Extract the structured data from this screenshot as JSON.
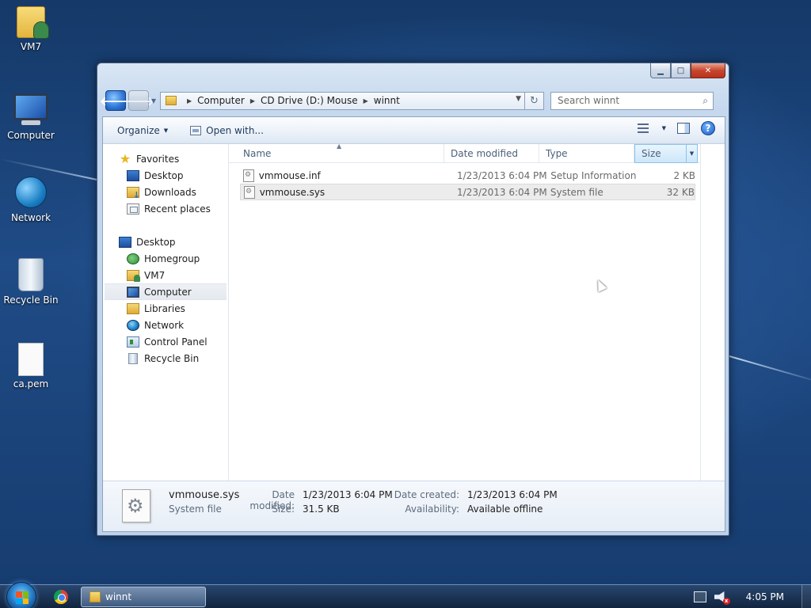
{
  "desktop": {
    "icons": [
      {
        "label": "VM7",
        "icon": "user-folder-icon"
      },
      {
        "label": "Computer",
        "icon": "computer-icon"
      },
      {
        "label": "Network",
        "icon": "network-icon"
      },
      {
        "label": "Recycle Bin",
        "icon": "recycle-bin-icon"
      },
      {
        "label": "ca.pem",
        "icon": "document-icon"
      }
    ]
  },
  "window": {
    "caption_buttons": {
      "minimize": "▁",
      "maximize": "□",
      "close": "✕"
    },
    "nav": {
      "back": "🡐",
      "forward": "🡒",
      "recent_dropdown": "▼"
    },
    "address": {
      "breadcrumbs": [
        "Computer",
        "CD Drive (D:) Mouse",
        "winnt"
      ],
      "separator": "▶",
      "dropdown": "▼",
      "refresh": "↻"
    },
    "search": {
      "placeholder": "Search winnt",
      "icon": "⌕"
    },
    "toolbar": {
      "organize": "Organize",
      "open_with": "Open with...",
      "caret": "▼",
      "help": "?"
    },
    "nav_pane": {
      "favorites_header": "Favorites",
      "favorites": [
        "Desktop",
        "Downloads",
        "Recent places"
      ],
      "tree_root": "Desktop",
      "tree": [
        "Homegroup",
        "VM7",
        "Computer",
        "Libraries",
        "Network",
        "Control Panel",
        "Recycle Bin"
      ],
      "selected": "Computer"
    },
    "columns": {
      "name": "Name",
      "date": "Date modified",
      "type": "Type",
      "size": "Size",
      "sort_indicator": "▲",
      "dropdown": "▼"
    },
    "files": [
      {
        "name": "vmmouse.inf",
        "date": "1/23/2013 6:04 PM",
        "type": "Setup Information",
        "size": "2 KB",
        "selected": false
      },
      {
        "name": "vmmouse.sys",
        "date": "1/23/2013 6:04 PM",
        "type": "System file",
        "size": "32 KB",
        "selected": true
      }
    ],
    "details": {
      "name": "vmmouse.sys",
      "kind": "System file",
      "date_modified_label": "Date modified:",
      "date_modified": "1/23/2013 6:04 PM",
      "size_label": "Size:",
      "size": "31.5 KB",
      "date_created_label": "Date created:",
      "date_created": "1/23/2013 6:04 PM",
      "availability_label": "Availability:",
      "availability": "Available offline"
    }
  },
  "taskbar": {
    "task_label": "winnt",
    "clock": "4:05 PM",
    "volume_muted_mark": "x"
  }
}
